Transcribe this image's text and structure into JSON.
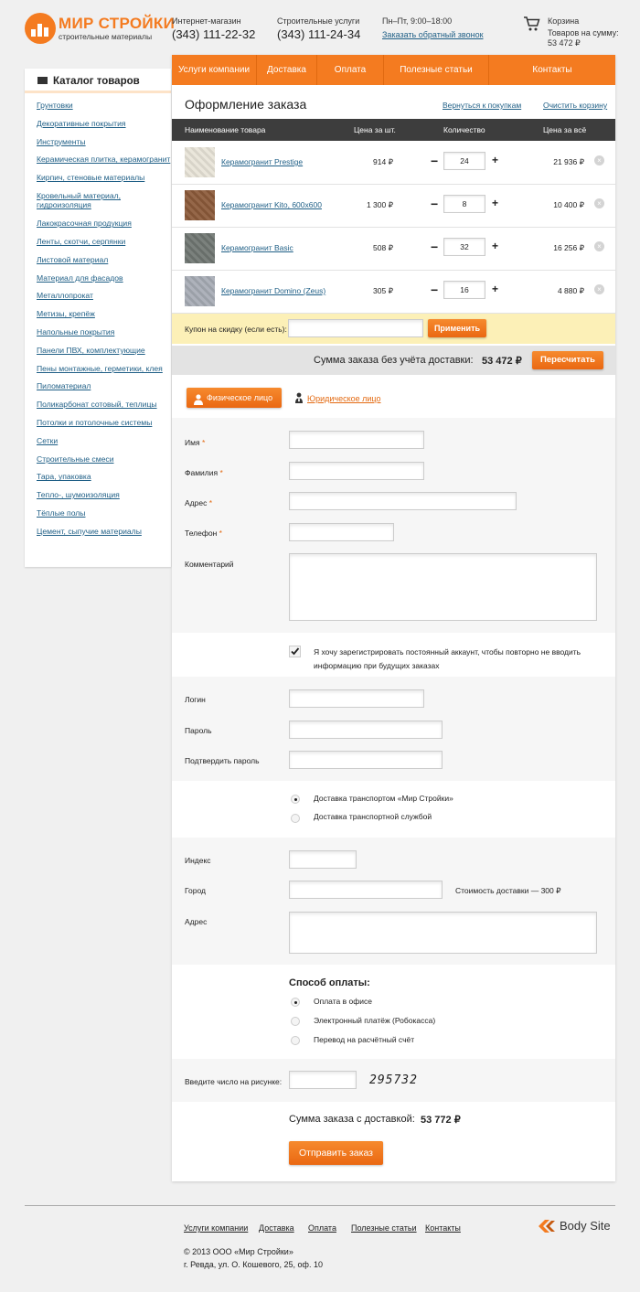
{
  "header": {
    "logo_title": "МИР СТРОЙКИ",
    "logo_subtitle": "строительные материалы",
    "shop_label": "Интернет-магазин",
    "shop_phone": "(343) 111-22-32",
    "services_label": "Строительные услуги",
    "services_phone": "(343) 111-24-34",
    "hours": "Пн–Пт, 9:00–18:00",
    "callback_link": "Заказать обратный звонок",
    "cart_label": "Корзина",
    "cart_items_label": "Товаров на сумму:",
    "cart_sum": "53 472 ₽"
  },
  "sidebar": {
    "title": "Каталог товаров",
    "items": [
      "Грунтовки",
      "Декоративные покрытия",
      "Инструменты",
      "Керамическая плитка, керамогранит",
      "Кирпич, стеновые материалы",
      "Кровельный материал, гидроизоляция",
      "Лакокрасочная продукция",
      "Ленты, скотчи, серпянки",
      "Листовой материал",
      "Материал для фасадов",
      "Металлопрокат",
      "Метизы, крепёж",
      "Напольные покрытия",
      "Панели ПВХ, комплектующие",
      "Пены монтажные, герметики, клея",
      "Пиломатериал",
      "Поликарбонат сотовый, теплицы",
      "Потолки и потолочные системы",
      "Сетки",
      "Строительные смеси",
      "Тара, упаковка",
      "Тепло-, шумоизоляция",
      "Тёплые полы",
      "Цемент, сыпучие материалы"
    ]
  },
  "nav": [
    "Услуги компании",
    "Доставка",
    "Оплата",
    "Полезные статьи",
    "Контакты"
  ],
  "order": {
    "title": "Оформление заказа",
    "back_link": "Вернуться к покупкам",
    "clear_link": "Очистить корзину",
    "columns": {
      "name": "Наименование товара",
      "price": "Цена за шт.",
      "qty": "Количество",
      "total": "Цена за всё"
    },
    "rows": [
      {
        "name": "Керамогранит Prestige",
        "price": "914 ₽",
        "qty": "24",
        "total": "21 936 ₽",
        "thumb_color": "#e8e4d8"
      },
      {
        "name": "Керамогранит Kito, 600х600",
        "price": "1 300 ₽",
        "qty": "8",
        "total": "10 400 ₽",
        "thumb_color": "#8c5a3a"
      },
      {
        "name": "Керамогранит Basic",
        "price": "508 ₽",
        "qty": "32",
        "total": "16 256 ₽",
        "thumb_color": "#707672"
      },
      {
        "name": "Керамогранит Domino (Zeus)",
        "price": "305 ₽",
        "qty": "16",
        "total": "4 880 ₽",
        "thumb_color": "#a7acb5"
      }
    ],
    "minus": "−",
    "plus": "+",
    "delete": "×",
    "coupon_label": "Купон на скидку (если есть):",
    "coupon_value": "",
    "apply_button": "Применить",
    "sum_label": "Сумма заказа без учёта доставки:",
    "sum_value": "53 472 ₽",
    "recalc_button": "Пересчитать"
  },
  "customer": {
    "tab_physical": "Физическое лицо",
    "tab_legal": "Юридическое лицо",
    "name_label": "Имя",
    "surname_label": "Фамилия",
    "address_label": "Адрес",
    "phone_label": "Телефон",
    "comment_label": "Комментарий",
    "required_mark": "*",
    "register_text": "Я хочу зарегистрировать постоянный аккаунт, чтобы повторно не вводить информацию при будущих заказах",
    "login_label": "Логин",
    "password_label": "Пароль",
    "confirm_label": "Подтвердить пароль"
  },
  "delivery": {
    "option_own": "Доставка транспортом «Мир Стройки»",
    "option_service": "Доставка транспортной службой",
    "index_label": "Индекс",
    "city_label": "Город",
    "cost_text": "Стоимость доставки — 300 ₽",
    "address_label": "Адрес"
  },
  "payment": {
    "title": "Способ оплаты:",
    "options": [
      "Оплата в офисе",
      "Электронный платёж (Робокасса)",
      "Перевод на расчётный счёт"
    ]
  },
  "captcha": {
    "label": "Введите число на рисунке:",
    "code": "295732"
  },
  "total": {
    "label": "Сумма заказа с доставкой:",
    "value": "53 772 ₽",
    "submit": "Отправить заказ"
  },
  "footer": {
    "links": [
      "Услуги компании",
      "Доставка",
      "Оплата",
      "Полезные статьи",
      "Контакты"
    ],
    "copyright": "© 2013 ООО «Мир Стройки»",
    "address": "г. Ревда, ул. О. Кошевого, 25, оф. 10",
    "dev_logo": "Body Site"
  },
  "colors": {
    "accent": "#f47b20",
    "link": "#1f5f86",
    "table_header": "#3d3d3d",
    "coupon_bg": "#fcf0b7"
  }
}
